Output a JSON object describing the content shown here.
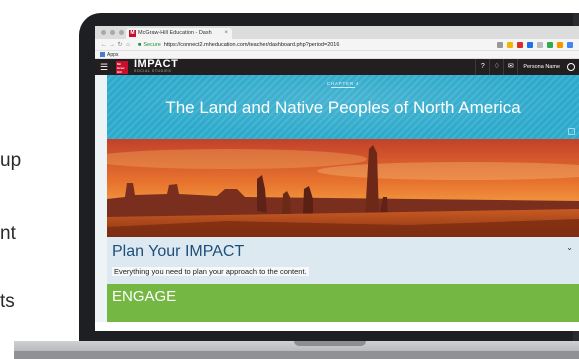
{
  "side_text": [
    "up",
    "nt",
    "ts"
  ],
  "browser": {
    "tab_title": "McGraw-Hill Education - Dash",
    "tab_favicon": "M",
    "secure_label": "Secure",
    "url": "https://connect2.mheducation.com/teacher/dashboard.php?period=2016",
    "bookmark_apps": "Apps"
  },
  "app_header": {
    "logo_text": "Mc Graw Hill Education",
    "product_name": "IMPACT",
    "product_sub": "SOCIAL STUDIES",
    "help_label": "?",
    "person_name": "Persona Name"
  },
  "hero": {
    "chapter": "CHAPTER 4",
    "title": "The Land and Native Peoples of North America"
  },
  "plan": {
    "title": "Plan Your IMPACT",
    "subtitle": "Everything you need to plan your approach to the content."
  },
  "engage": {
    "title": "ENGAGE"
  },
  "colors": {
    "hero_teal": "#2fa8c9",
    "engage_green": "#74b843",
    "brand_red": "#c8102e",
    "header_dark": "#231f20",
    "plan_title_blue": "#1d4f7a"
  }
}
